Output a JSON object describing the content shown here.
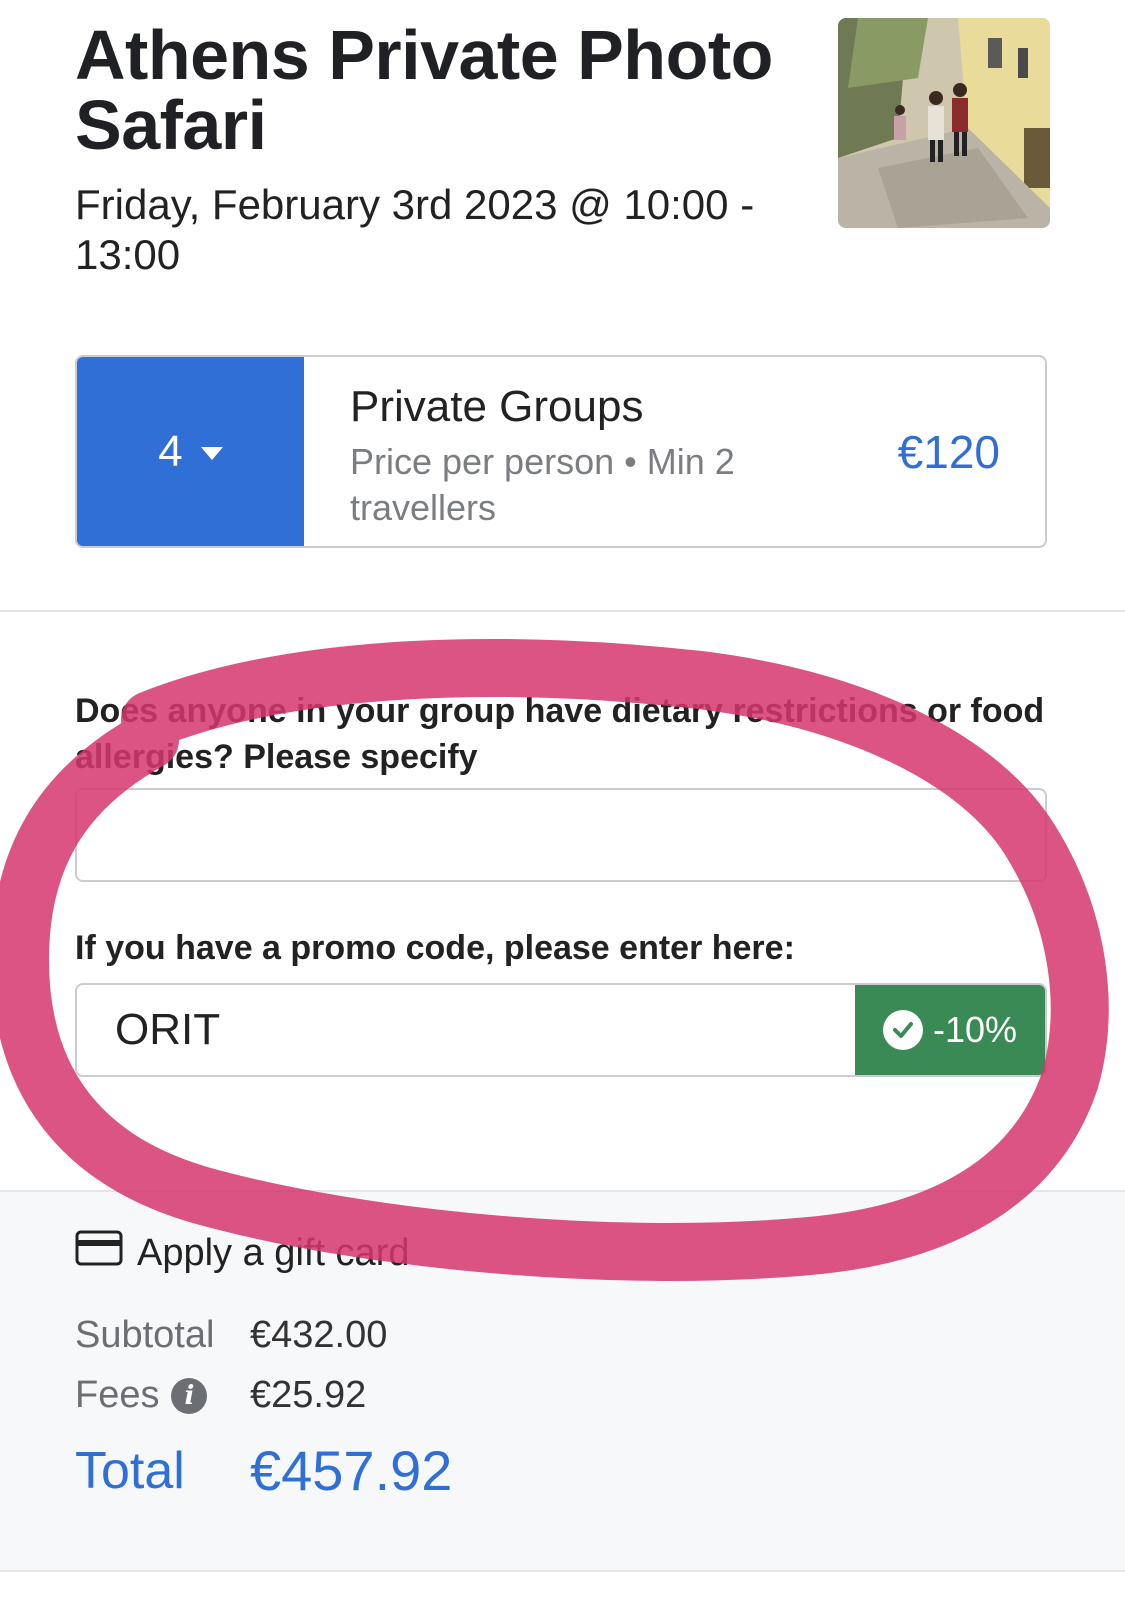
{
  "header": {
    "title": "Athens Private Photo Safari",
    "datetime": "Friday, February 3rd 2023 @ 10:00 - 13:00"
  },
  "ticket": {
    "quantity": "4",
    "name": "Private Groups",
    "description": "Price per person • Min 2 travellers",
    "price": "€120",
    "accent_color": "#2f6fd6"
  },
  "form": {
    "dietary_label": "Does anyone in your group have dietary restrictions or food allergies? Please specify",
    "dietary_value": "",
    "promo_label": "If you have a promo code, please enter here:",
    "promo_value": "ORIT",
    "promo_discount": "-10%",
    "promo_status_color": "#3a8a55"
  },
  "summary": {
    "gift_card_label": "Apply a gift card",
    "subtotal_label": "Subtotal",
    "subtotal_value": "€432.00",
    "fees_label": "Fees",
    "fees_value": "€25.92",
    "total_label": "Total",
    "total_value": "€457.92"
  },
  "icons": {
    "caret": "chevron-down-icon",
    "check": "check-circle-icon",
    "card": "credit-card-icon",
    "info": "info-icon"
  },
  "annotation_color": "#d6366f"
}
